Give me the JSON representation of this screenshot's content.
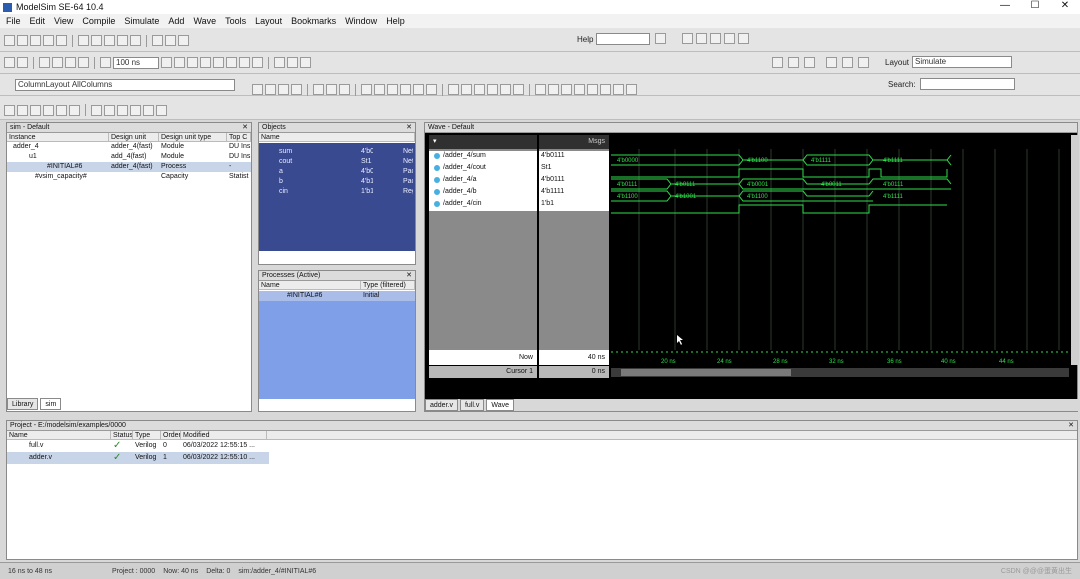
{
  "window": {
    "title": "ModelSim SE-64 10.4",
    "minimize": "—",
    "maximize": "☐",
    "close": "✕"
  },
  "menu": [
    "File",
    "Edit",
    "View",
    "Compile",
    "Simulate",
    "Add",
    "Wave",
    "Tools",
    "Layout",
    "Bookmarks",
    "Window",
    "Help"
  ],
  "toolbar": {
    "help_label": "Help",
    "run_length": "100 ns",
    "column_layout_label": "ColumnLayout",
    "column_layout_value": "AllColumns",
    "layout_label": "Layout",
    "layout_value": "Simulate",
    "search_label": "Search:"
  },
  "sim_panel": {
    "title": "sim - Default",
    "columns": [
      "Instance",
      "Design unit",
      "Design unit type",
      "Top C"
    ],
    "rows": [
      {
        "instance": "adder_4",
        "unit": "adder_4(fast)",
        "type": "Module",
        "top": "DU Ins"
      },
      {
        "instance": "u1",
        "unit": "add_4(fast)",
        "type": "Module",
        "top": "DU Ins"
      },
      {
        "instance": "#INITIAL#6",
        "unit": "adder_4(fast)",
        "type": "Process",
        "top": "-"
      },
      {
        "instance": "#vsim_capacity#",
        "unit": "",
        "type": "Capacity",
        "top": "Statist"
      }
    ],
    "tabs": [
      "Library",
      "sim"
    ]
  },
  "objects_panel": {
    "title": "Objects",
    "columns": [
      "Name"
    ],
    "rows": [
      {
        "name": "sum",
        "value": "4'b0111",
        "kind": "Net"
      },
      {
        "name": "cout",
        "value": "St1",
        "kind": "Net"
      },
      {
        "name": "a",
        "value": "4'b0111",
        "kind": "Pack..."
      },
      {
        "name": "b",
        "value": "4'b1111",
        "kind": "Pack..."
      },
      {
        "name": "cin",
        "value": "1'b1",
        "kind": "Regi..."
      }
    ]
  },
  "processes_panel": {
    "title": "Processes (Active)",
    "columns": [
      "Name",
      "Type (filtered)"
    ],
    "rows": [
      {
        "name": "#INITIAL#6",
        "type": "Initial"
      }
    ]
  },
  "wave_panel": {
    "title": "Wave - Default",
    "msgs_header": "Msgs",
    "signals": [
      {
        "path": "/adder_4/sum",
        "value": "4'b0111"
      },
      {
        "path": "/adder_4/cout",
        "value": "St1"
      },
      {
        "path": "/adder_4/a",
        "value": "4'b0111"
      },
      {
        "path": "/adder_4/b",
        "value": "4'b1111"
      },
      {
        "path": "/adder_4/cin",
        "value": "1'b1"
      }
    ],
    "now_label": "Now",
    "now_value": "40 ns",
    "cursor_label": "Cursor 1",
    "cursor_value": "0 ns",
    "time_ticks": [
      "20 ns",
      "24 ns",
      "28 ns",
      "32 ns",
      "36 ns",
      "40 ns",
      "44 ns"
    ],
    "wave_labels": {
      "sum": [
        "4'b0000",
        "4'b1100",
        "4'b1111",
        "4'b1111"
      ],
      "a": [
        "4'b0111",
        "4'b0111",
        "4'b0001",
        "4'b0011",
        "4'b0111"
      ],
      "b": [
        "4'b1100",
        "4'b1001",
        "4'b1100",
        "4'b1111"
      ]
    },
    "tabs": [
      "adder.v",
      "full.v",
      "Wave"
    ]
  },
  "project_panel": {
    "title": "Project - E:/modelsim/examples/0000",
    "columns": [
      "Name",
      "Status",
      "Type",
      "Order",
      "Modified"
    ],
    "rows": [
      {
        "name": "full.v",
        "status": "✓",
        "type": "Verilog",
        "order": "0",
        "modified": "06/03/2022 12:55:15 ..."
      },
      {
        "name": "adder.v",
        "status": "✓",
        "type": "Verilog",
        "order": "1",
        "modified": "06/03/2022 12:55:10 ..."
      }
    ]
  },
  "status_bar": {
    "range": "16 ns to 48 ns",
    "project": "Project : 0000",
    "now": "Now: 40 ns",
    "delta": "Delta: 0",
    "context": "sim:/adder_4/#INITIAL#6"
  },
  "watermark": "CSDN @@@蛋黄出生"
}
